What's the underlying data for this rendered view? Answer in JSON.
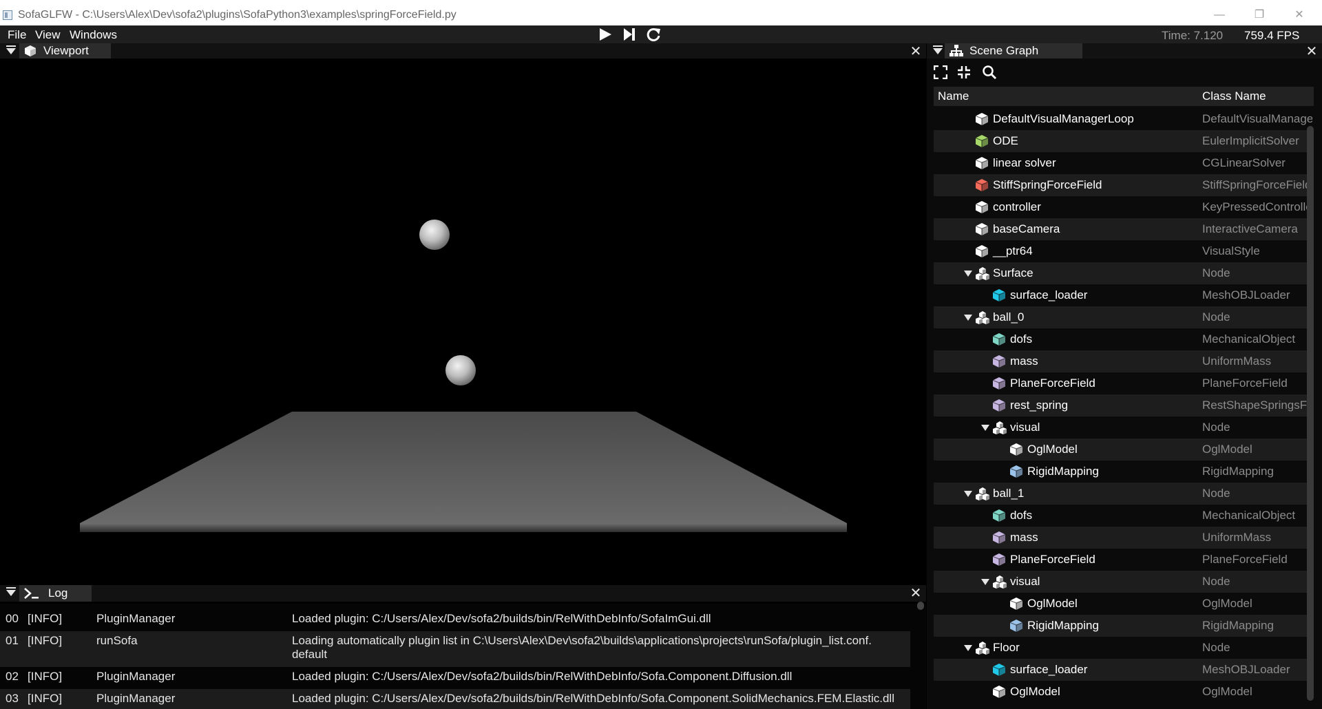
{
  "window": {
    "title": "SofaGLFW - C:\\Users\\Alex\\Dev\\sofa2\\plugins\\SofaPython3\\examples\\springForceField.py",
    "minimize": "—",
    "maximize": "❐",
    "close": "✕"
  },
  "menu": {
    "items": [
      "File",
      "View",
      "Windows"
    ],
    "time": "Time: 7.120",
    "fps": "759.4 FPS"
  },
  "viewport": {
    "title": "Viewport"
  },
  "log": {
    "title": "Log",
    "entries": [
      {
        "idx": "00",
        "level": "[INFO]",
        "source": "PluginManager",
        "message": "Loaded plugin: C:/Users/Alex/Dev/sofa2/builds/bin/RelWithDebInfo/SofaImGui.dll",
        "message2": ""
      },
      {
        "idx": "01",
        "level": "[INFO]",
        "source": "runSofa",
        "message": "Loading automatically plugin list in C:\\Users\\Alex\\Dev\\sofa2\\builds\\applications\\projects\\runSofa/plugin_list.conf.",
        "message2": "default"
      },
      {
        "idx": "02",
        "level": "[INFO]",
        "source": "PluginManager",
        "message": "Loaded plugin: C:/Users/Alex/Dev/sofa2/builds/bin/RelWithDebInfo/Sofa.Component.Diffusion.dll",
        "message2": ""
      },
      {
        "idx": "03",
        "level": "[INFO]",
        "source": "PluginManager",
        "message": "Loaded plugin: C:/Users/Alex/Dev/sofa2/builds/bin/RelWithDebInfo/Sofa.Component.SolidMechanics.FEM.Elastic.dll",
        "message2": ""
      }
    ]
  },
  "scene_graph": {
    "title": "Scene Graph",
    "col_name": "Name",
    "col_class": "Class Name",
    "rows": [
      {
        "name": "DefaultVisualManagerLoop",
        "class": "DefaultVisualManagerLoop",
        "depth": 0,
        "icon": "component-icon",
        "color": "#ffffff",
        "node": false
      },
      {
        "name": "ODE",
        "class": "EulerImplicitSolver",
        "depth": 0,
        "icon": "solver-icon",
        "color": "#a6d96a",
        "node": false
      },
      {
        "name": "linear solver",
        "class": "CGLinearSolver",
        "depth": 0,
        "icon": "component-icon",
        "color": "#ffffff",
        "node": false
      },
      {
        "name": "StiffSpringForceField",
        "class": "StiffSpringForceField",
        "depth": 0,
        "icon": "forcefield-icon",
        "color": "#f26b5b",
        "node": false
      },
      {
        "name": "controller",
        "class": "KeyPressedController",
        "depth": 0,
        "icon": "component-icon",
        "color": "#ffffff",
        "node": false
      },
      {
        "name": "baseCamera",
        "class": "InteractiveCamera",
        "depth": 0,
        "icon": "component-icon",
        "color": "#ffffff",
        "node": false
      },
      {
        "name": "__ptr64",
        "class": "VisualStyle",
        "depth": 0,
        "icon": "component-icon",
        "color": "#ffffff",
        "node": false
      },
      {
        "name": "Surface",
        "class": "Node",
        "depth": 0,
        "icon": "node-icon",
        "color": "#ffffff",
        "node": true
      },
      {
        "name": "surface_loader",
        "class": "MeshOBJLoader",
        "depth": 1,
        "icon": "loader-icon",
        "color": "#22c8e8",
        "node": false
      },
      {
        "name": "ball_0",
        "class": "Node",
        "depth": 0,
        "icon": "node-icon",
        "color": "#ffffff",
        "node": true
      },
      {
        "name": "dofs",
        "class": "MechanicalObject",
        "depth": 1,
        "icon": "state-icon",
        "color": "#7fd6c6",
        "node": false
      },
      {
        "name": "mass",
        "class": "UniformMass",
        "depth": 1,
        "icon": "mass-icon",
        "color": "#c8b6e2",
        "node": false
      },
      {
        "name": "PlaneForceField",
        "class": "PlaneForceField",
        "depth": 1,
        "icon": "forcefield-icon",
        "color": "#c8b6e2",
        "node": false
      },
      {
        "name": "rest_spring",
        "class": "RestShapeSpringsForceField",
        "depth": 1,
        "icon": "forcefield-icon",
        "color": "#c8b6e2",
        "node": false
      },
      {
        "name": "visual",
        "class": "Node",
        "depth": 1,
        "icon": "node-icon",
        "color": "#ffffff",
        "node": true
      },
      {
        "name": "OglModel",
        "class": "OglModel",
        "depth": 2,
        "icon": "visual-icon",
        "color": "#ffffff",
        "node": false
      },
      {
        "name": "RigidMapping",
        "class": "RigidMapping",
        "depth": 2,
        "icon": "mapping-icon",
        "color": "#9cc3ea",
        "node": false
      },
      {
        "name": "ball_1",
        "class": "Node",
        "depth": 0,
        "icon": "node-icon",
        "color": "#ffffff",
        "node": true
      },
      {
        "name": "dofs",
        "class": "MechanicalObject",
        "depth": 1,
        "icon": "state-icon",
        "color": "#7fd6c6",
        "node": false
      },
      {
        "name": "mass",
        "class": "UniformMass",
        "depth": 1,
        "icon": "mass-icon",
        "color": "#c8b6e2",
        "node": false
      },
      {
        "name": "PlaneForceField",
        "class": "PlaneForceField",
        "depth": 1,
        "icon": "forcefield-icon",
        "color": "#c8b6e2",
        "node": false
      },
      {
        "name": "visual",
        "class": "Node",
        "depth": 1,
        "icon": "node-icon",
        "color": "#ffffff",
        "node": true
      },
      {
        "name": "OglModel",
        "class": "OglModel",
        "depth": 2,
        "icon": "visual-icon",
        "color": "#ffffff",
        "node": false
      },
      {
        "name": "RigidMapping",
        "class": "RigidMapping",
        "depth": 2,
        "icon": "mapping-icon",
        "color": "#9cc3ea",
        "node": false
      },
      {
        "name": "Floor",
        "class": "Node",
        "depth": 0,
        "icon": "node-icon",
        "color": "#ffffff",
        "node": true
      },
      {
        "name": "surface_loader",
        "class": "MeshOBJLoader",
        "depth": 1,
        "icon": "loader-icon",
        "color": "#22c8e8",
        "node": false
      },
      {
        "name": "OglModel",
        "class": "OglModel",
        "depth": 1,
        "icon": "visual-icon",
        "color": "#ffffff",
        "node": false
      }
    ]
  }
}
